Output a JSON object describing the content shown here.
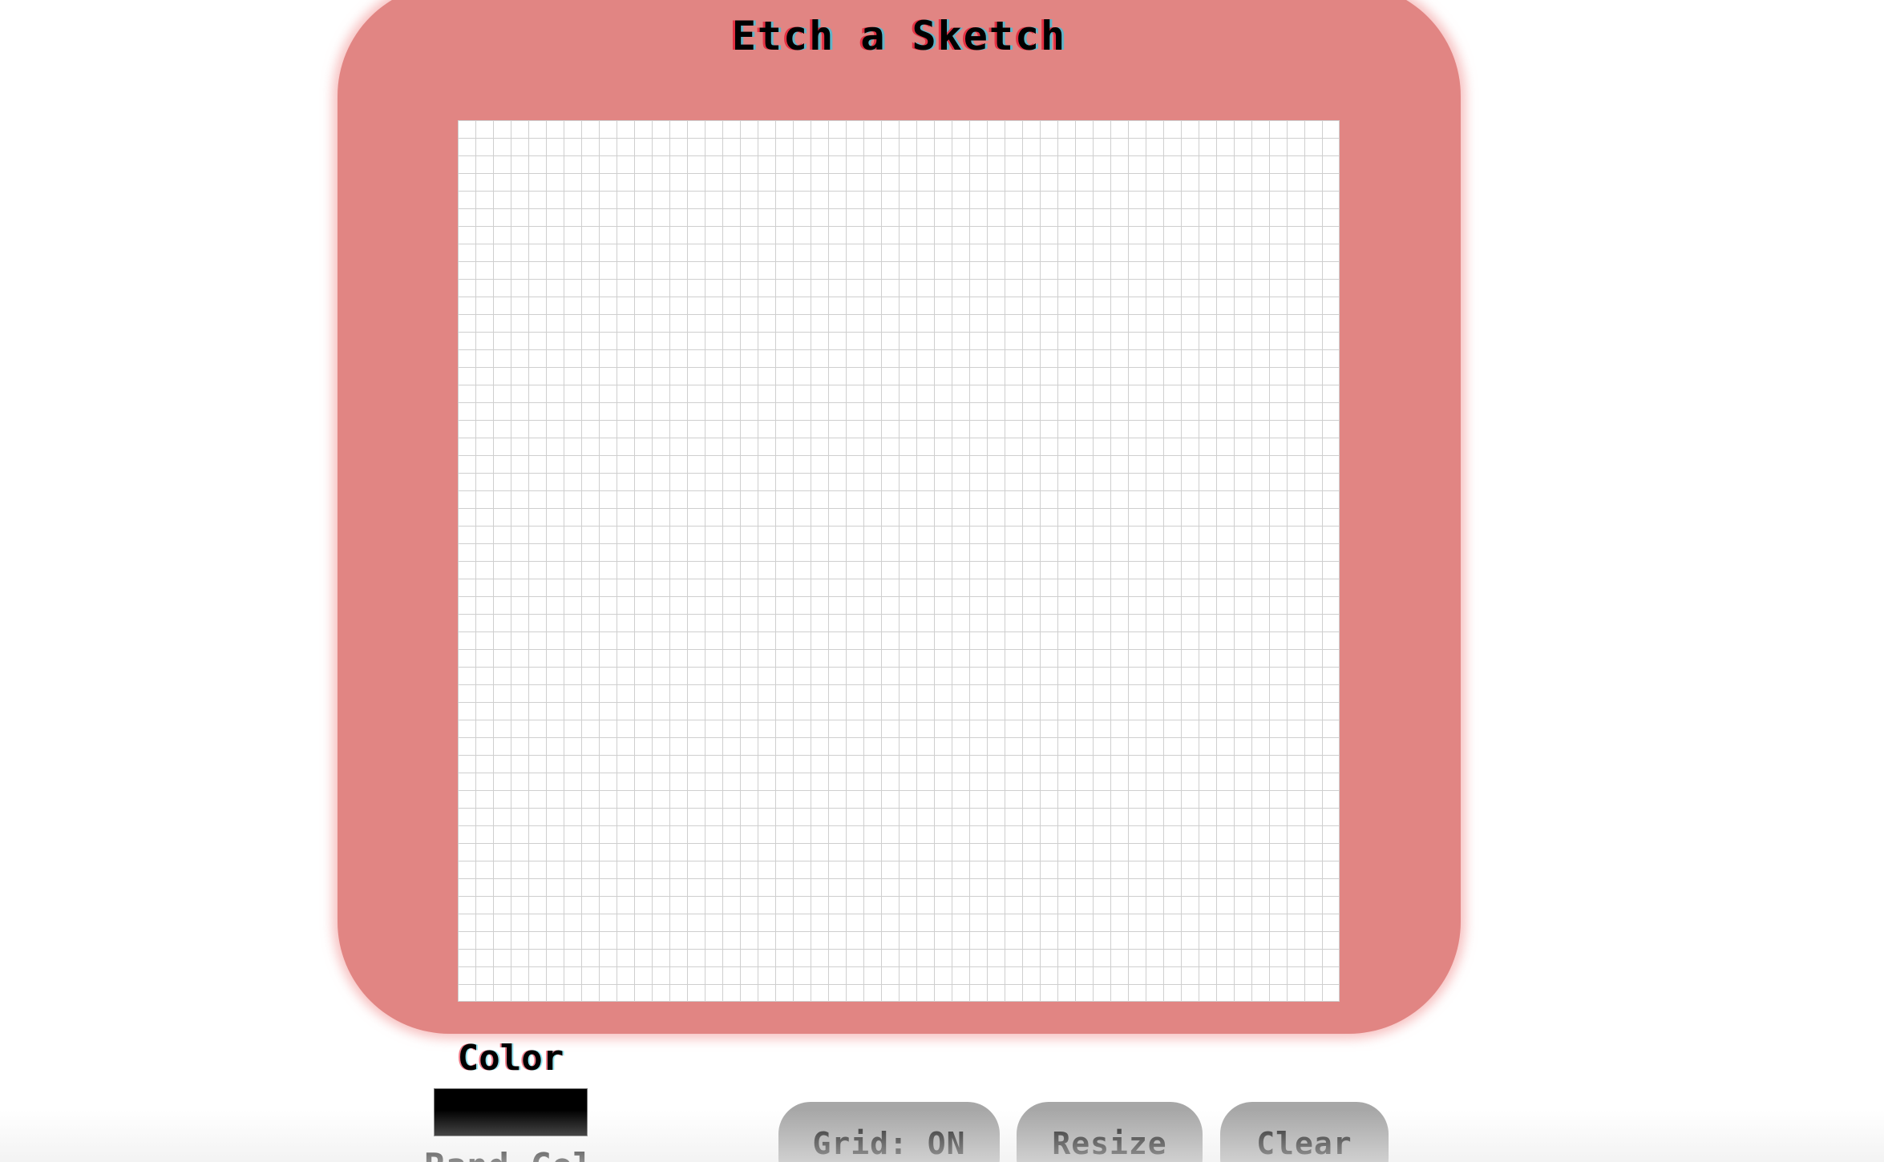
{
  "app": {
    "title": "Etch a Sketch"
  },
  "board": {
    "grid_cells_per_side": 50,
    "frame_color": "#e18583",
    "grid_line_color": "#cfcfcf"
  },
  "controls": {
    "color_label": "Color",
    "color_value": "#000000",
    "random_label": "Rand Col",
    "grid_toggle_label": "Grid: ON",
    "resize_label": "Resize",
    "clear_label": "Clear"
  }
}
